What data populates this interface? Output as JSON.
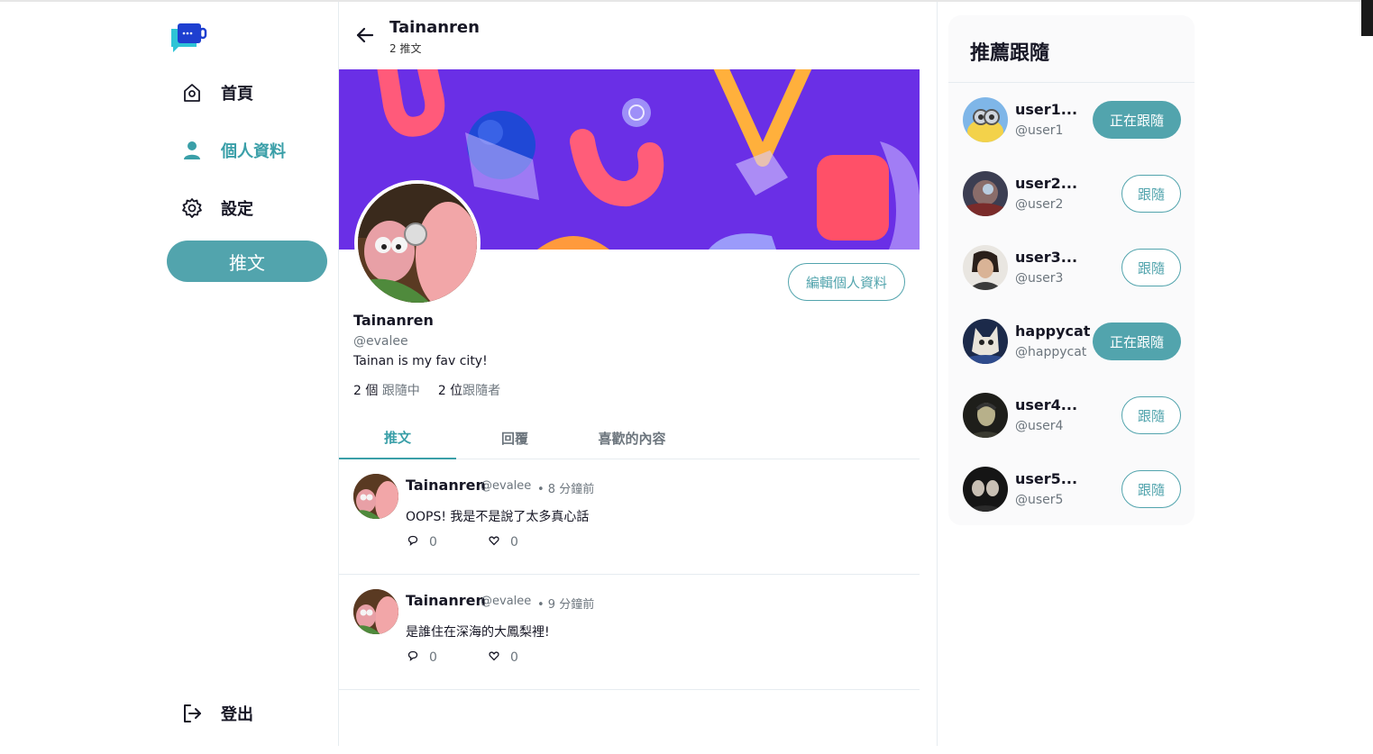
{
  "sidebar": {
    "logo": "chat-bubble-logo",
    "items": [
      {
        "label": "首頁",
        "icon": "home-icon"
      },
      {
        "label": "個人資料",
        "icon": "user-icon"
      },
      {
        "label": "設定",
        "icon": "gear-icon"
      }
    ],
    "tweet_button": "推文",
    "logout_label": "登出"
  },
  "header": {
    "title": "Tainanren",
    "subtitle": "2 推文"
  },
  "profile": {
    "name": "Tainanren",
    "handle": "@evalee",
    "bio": "Tainan is my fav city!",
    "edit_button": "編輯個人資料",
    "following_count": "2 個",
    "following_label": "跟隨中",
    "followers_count": "2 位",
    "followers_label": "跟隨者"
  },
  "tabs": [
    {
      "label": "推文",
      "active": true
    },
    {
      "label": "回覆",
      "active": false
    },
    {
      "label": "喜歡的內容",
      "active": false
    }
  ],
  "tweets": [
    {
      "name": "Tainanren",
      "handle": "@evalee",
      "time": "• 8 分鐘前",
      "text": "OOPS! 我是不是說了太多真心話",
      "replies": "0",
      "likes": "0"
    },
    {
      "name": "Tainanren",
      "handle": "@evalee",
      "time": "• 9 分鐘前",
      "text": "是誰住在深海的大鳳梨裡!",
      "replies": "0",
      "likes": "0"
    }
  ],
  "suggestions": {
    "title": "推薦跟隨",
    "users": [
      {
        "name": "user1...",
        "handle": "@user1",
        "button": "正在跟隨",
        "following": true
      },
      {
        "name": "user2...",
        "handle": "@user2",
        "button": "跟隨",
        "following": false
      },
      {
        "name": "user3...",
        "handle": "@user3",
        "button": "跟隨",
        "following": false
      },
      {
        "name": "happycat",
        "handle": "@happycat",
        "button": "正在跟隨",
        "following": true
      },
      {
        "name": "user4...",
        "handle": "@user4",
        "button": "跟隨",
        "following": false
      },
      {
        "name": "user5...",
        "handle": "@user5",
        "button": "跟隨",
        "following": false
      }
    ]
  },
  "colors": {
    "accent": "#52a4ad",
    "accent_text": "#3a9fa8",
    "banner": "#6a2fe6"
  }
}
